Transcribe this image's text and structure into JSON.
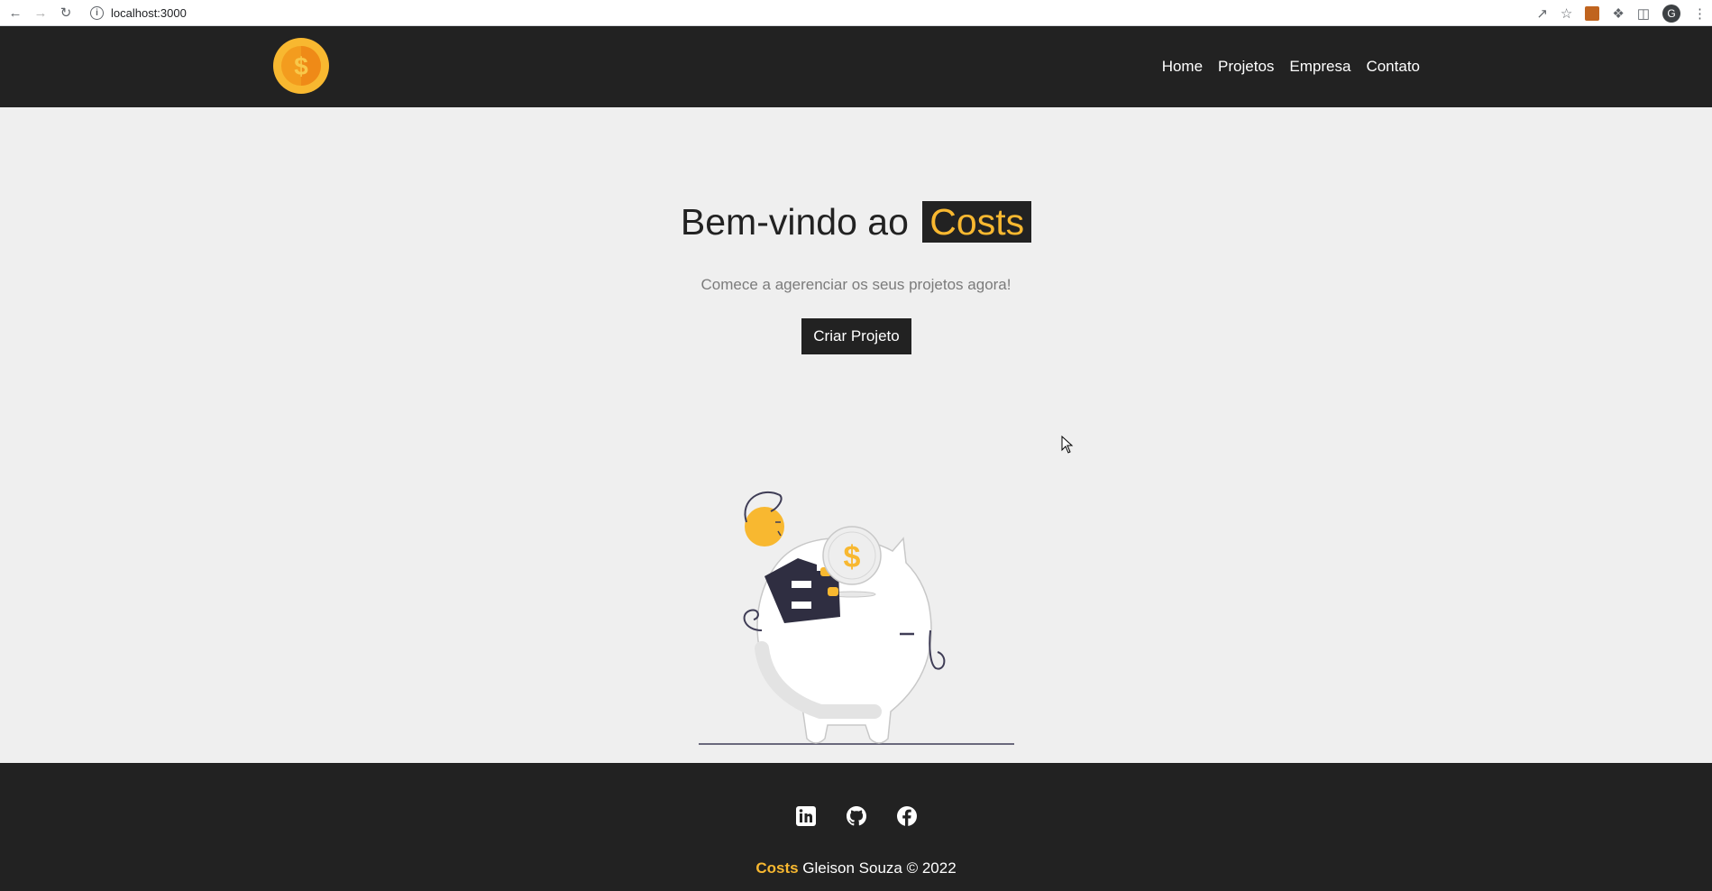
{
  "browser": {
    "url": "localhost:3000",
    "profile_initial": "G"
  },
  "navbar": {
    "logo_icon": "coin-dollar-icon",
    "links": [
      {
        "label": "Home"
      },
      {
        "label": "Projetos"
      },
      {
        "label": "Empresa"
      },
      {
        "label": "Contato"
      }
    ]
  },
  "hero": {
    "title_prefix": "Bem-vindo ao",
    "title_brand": "Costs",
    "subtitle": "Comece a agerenciar os seus projetos agora!",
    "cta_label": "Criar Projeto",
    "illustration": "piggy-bank-savings-illustration"
  },
  "footer": {
    "social_icons": [
      "linkedin-icon",
      "github-icon",
      "facebook-icon"
    ],
    "brand": "Costs",
    "copyright": "Gleison Souza © 2022"
  },
  "colors": {
    "dark": "#222222",
    "accent": "#f8b830",
    "background": "#efefef"
  }
}
